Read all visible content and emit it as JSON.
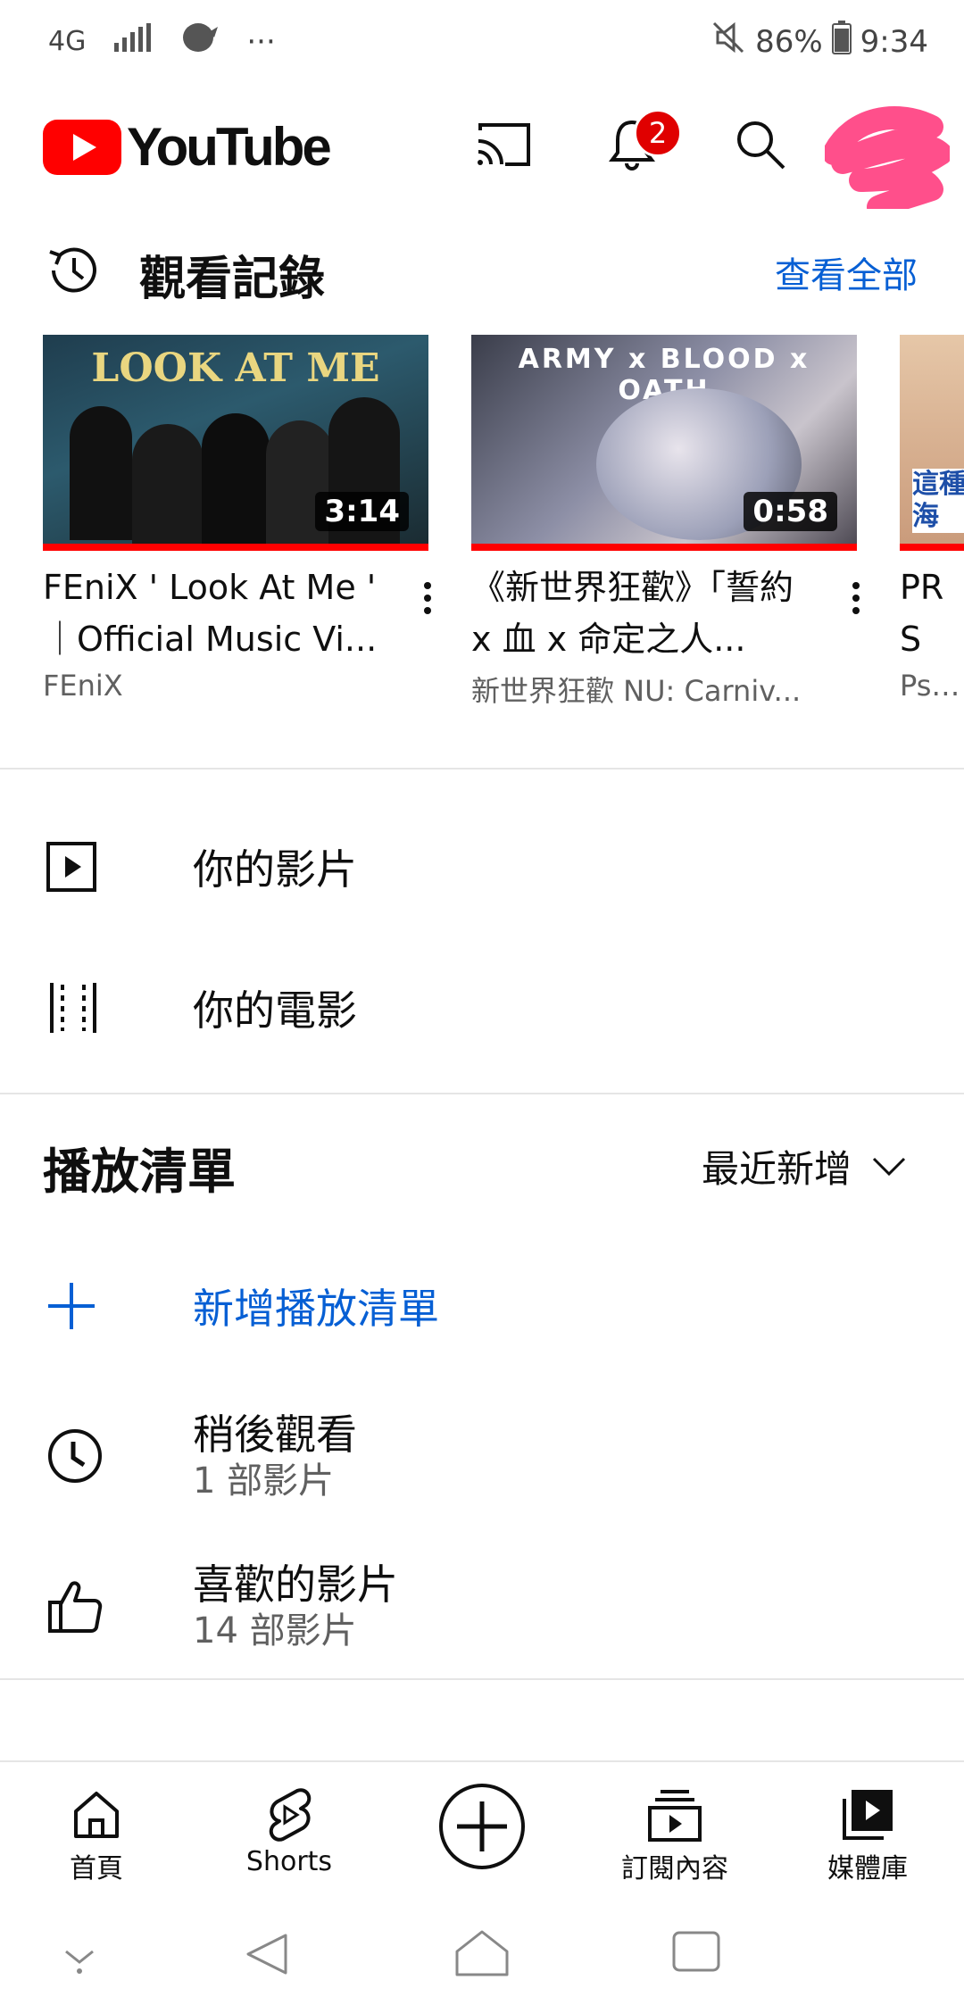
{
  "status_bar": {
    "network": "4G",
    "battery": "86%",
    "time": "9:34",
    "more": "···"
  },
  "header": {
    "logo_text": "YouTube",
    "notification_count": "2"
  },
  "history": {
    "title": "觀看記錄",
    "view_all": "查看全部",
    "videos": [
      {
        "thumb_text": "LOOK AT ME",
        "duration": "3:14",
        "title": "FEniX ' Look At Me ' ｜Official Music Vi...",
        "channel": "FEniX"
      },
      {
        "thumb_text": "ARMY x BLOOD x OATH",
        "duration": "0:58",
        "title": "《新世界狂歡》「誓約 x 血 x 命定之人...",
        "channel": "新世界狂歡 NU: Carniv..."
      },
      {
        "thumb_text": "這種 海",
        "title": "PRS 啃的",
        "channel": "Psyn"
      }
    ]
  },
  "library": {
    "your_videos": "你的影片",
    "your_movies": "你的電影"
  },
  "playlists": {
    "title": "播放清單",
    "sort_label": "最近新增",
    "new_playlist": "新增播放清單",
    "items": [
      {
        "name": "稍後觀看",
        "count": "1 部影片"
      },
      {
        "name": "喜歡的影片",
        "count": "14 部影片"
      }
    ]
  },
  "bottom_nav": {
    "home": "首頁",
    "shorts": "Shorts",
    "subscriptions": "訂閱內容",
    "library": "媒體庫"
  },
  "colors": {
    "brand_red": "#ff0000",
    "link_blue": "#065fd4",
    "text": "#0f0f0f",
    "secondary": "#606060"
  }
}
